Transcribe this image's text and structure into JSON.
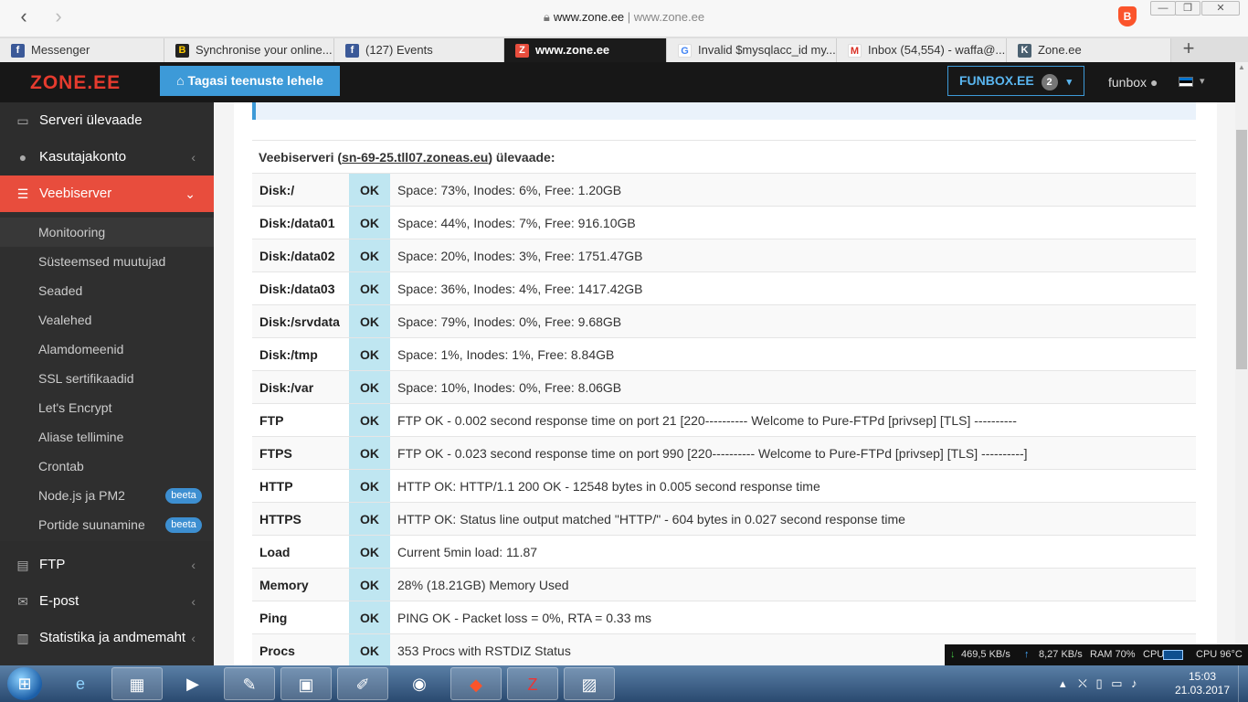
{
  "browser": {
    "back_icon": "‹",
    "forward_icon": "›",
    "url_host": "www.zone.ee",
    "url_sep": " | ",
    "url_full": "www.zone.ee",
    "window_minimize": "—",
    "window_restore": "❐",
    "window_close": "✕",
    "new_tab": "+",
    "tabs": [
      {
        "label": "Messenger",
        "icon": "f",
        "color": "#3b5998"
      },
      {
        "label": "Synchronise your online...",
        "icon": "B",
        "color": "#ffcc00"
      },
      {
        "label": "(127) Events",
        "icon": "f",
        "color": "#3b5998"
      },
      {
        "label": "www.zone.ee",
        "icon": "Z",
        "color": "#e84d3d"
      },
      {
        "label": "Invalid $mysqlacc_id my...",
        "icon": "G",
        "color": "#4285f4"
      },
      {
        "label": "Inbox (54,554) - waffa@...",
        "icon": "M",
        "color": "#d93025"
      },
      {
        "label": "Zone.ee",
        "icon": "K",
        "color": "#4a6070"
      }
    ]
  },
  "header": {
    "logo": "ZONE.EE",
    "back_button": "Tagasi teenuste lehele",
    "account_button": "FUNBOX.EE",
    "account_count": "2",
    "user": "funbox"
  },
  "sidebar": {
    "items": [
      {
        "label": "Serveri ülevaade",
        "icon": "monitor-icon"
      },
      {
        "label": "Kasutajakonto",
        "icon": "user-icon"
      },
      {
        "label": "Veebiserver",
        "icon": "server-icon"
      },
      {
        "label": "FTP",
        "icon": "file-code-icon"
      },
      {
        "label": "E-post",
        "icon": "envelope-icon"
      },
      {
        "label": "Statistika ja andmemaht",
        "icon": "bar-chart-icon"
      }
    ],
    "submenu": [
      {
        "label": "Monitooring"
      },
      {
        "label": "Süsteemsed muutujad"
      },
      {
        "label": "Seaded"
      },
      {
        "label": "Vealehed"
      },
      {
        "label": "Alamdomeenid"
      },
      {
        "label": "SSL sertifikaadid"
      },
      {
        "label": "Let's Encrypt"
      },
      {
        "label": "Aliase tellimine"
      },
      {
        "label": "Crontab"
      },
      {
        "label": "Node.js ja PM2",
        "badge": "beeta"
      },
      {
        "label": "Portide suunamine",
        "badge": "beeta"
      }
    ]
  },
  "overview": {
    "prefix": "Veebiserveri (",
    "host": "sn-69-25.tll07.zoneas.eu",
    "suffix": ") ülevaade:",
    "checks": [
      {
        "name": "Disk:/",
        "status": "OK",
        "message": "Space: 73%, Inodes: 6%, Free: 1.20GB"
      },
      {
        "name": "Disk:/data01",
        "status": "OK",
        "message": "Space: 44%, Inodes: 7%, Free: 916.10GB"
      },
      {
        "name": "Disk:/data02",
        "status": "OK",
        "message": "Space: 20%, Inodes: 3%, Free: 1751.47GB"
      },
      {
        "name": "Disk:/data03",
        "status": "OK",
        "message": "Space: 36%, Inodes: 4%, Free: 1417.42GB"
      },
      {
        "name": "Disk:/srvdata",
        "status": "OK",
        "message": "Space: 79%, Inodes: 0%, Free: 9.68GB"
      },
      {
        "name": "Disk:/tmp",
        "status": "OK",
        "message": "Space: 1%, Inodes: 1%, Free: 8.84GB"
      },
      {
        "name": "Disk:/var",
        "status": "OK",
        "message": "Space: 10%, Inodes: 0%, Free: 8.06GB"
      },
      {
        "name": "FTP",
        "status": "OK",
        "message": "FTP OK - 0.002 second response time on port 21 [220---------- Welcome to Pure-FTPd [privsep] [TLS] ----------"
      },
      {
        "name": "FTPS",
        "status": "OK",
        "message": "FTP OK - 0.023 second response time on port 990 [220---------- Welcome to Pure-FTPd [privsep] [TLS] ----------]"
      },
      {
        "name": "HTTP",
        "status": "OK",
        "message": "HTTP OK: HTTP/1.1 200 OK - 12548 bytes in 0.005 second response time"
      },
      {
        "name": "HTTPS",
        "status": "OK",
        "message": "HTTP OK: Status line output matched \"HTTP/\" - 604 bytes in 0.027 second response time"
      },
      {
        "name": "Load",
        "status": "OK",
        "message": "Current 5min load: 11.87"
      },
      {
        "name": "Memory",
        "status": "OK",
        "message": "28% (18.21GB) Memory Used"
      },
      {
        "name": "Ping",
        "status": "OK",
        "message": "PING OK - Packet loss = 0%, RTA = 0.33 ms"
      },
      {
        "name": "Procs",
        "status": "OK",
        "message": "353 Procs with RSTDIZ Status"
      }
    ]
  },
  "netmeter": {
    "down": "469,5 KB/s",
    "up": "8,27 KB/s",
    "ram": "RAM 70%",
    "cpu": "CPU",
    "cpu_temp": "CPU 96°C"
  },
  "taskbar": {
    "time": "15:03",
    "date": "21.03.2017"
  }
}
